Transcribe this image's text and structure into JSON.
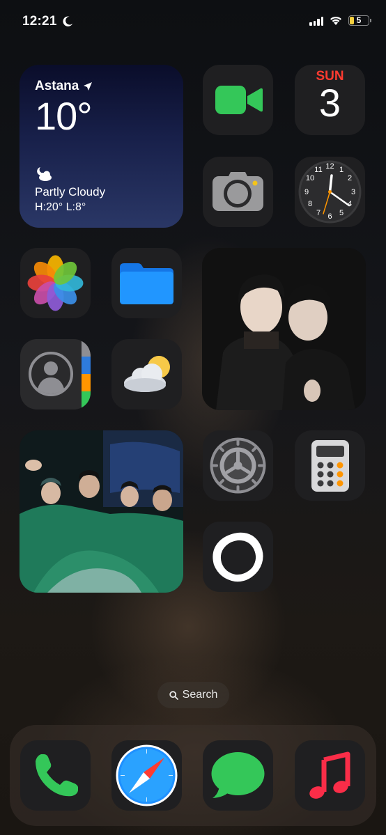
{
  "status_bar": {
    "time": "12:21",
    "moon_icon": "moon-icon",
    "signal_icon": "cellular-signal-icon",
    "wifi_icon": "wifi-icon",
    "battery_level": "5",
    "battery_color": "#f4d03f"
  },
  "weather_widget": {
    "city": "Astana",
    "location_icon": "location-arrow-icon",
    "temperature": "10°",
    "condition_icon": "partly-cloudy-night-icon",
    "condition": "Partly Cloudy",
    "high_low": "H:20° L:8°"
  },
  "apps": {
    "facetime": {
      "icon": "facetime-icon",
      "color": "#34c759"
    },
    "calendar": {
      "day": "SUN",
      "date": "3",
      "day_color": "#ff3b30"
    },
    "camera": {
      "icon": "camera-icon"
    },
    "clock": {
      "icon": "clock-icon",
      "numbers": [
        "12",
        "1",
        "2",
        "3",
        "4",
        "5",
        "6",
        "7",
        "8",
        "9",
        "10",
        "11"
      ]
    },
    "photos": {
      "icon": "photos-flower-icon"
    },
    "files": {
      "icon": "folder-icon",
      "color": "#1a8cff"
    },
    "contacts": {
      "icon": "contacts-person-icon"
    },
    "weather": {
      "icon": "sun-behind-cloud-icon"
    },
    "settings": {
      "icon": "gear-icon"
    },
    "calculator": {
      "icon": "calculator-icon"
    },
    "circle_app": {
      "icon": "rounded-ring-icon"
    }
  },
  "search": {
    "label": "Search",
    "icon": "magnifier-icon"
  },
  "dock": {
    "phone": {
      "icon": "phone-icon",
      "color": "#34c759"
    },
    "safari": {
      "icon": "safari-compass-icon",
      "color": "#1e90ff"
    },
    "messages": {
      "icon": "messages-bubble-icon",
      "color": "#34c759"
    },
    "music": {
      "icon": "music-note-icon",
      "color": "#fa2d48"
    }
  }
}
